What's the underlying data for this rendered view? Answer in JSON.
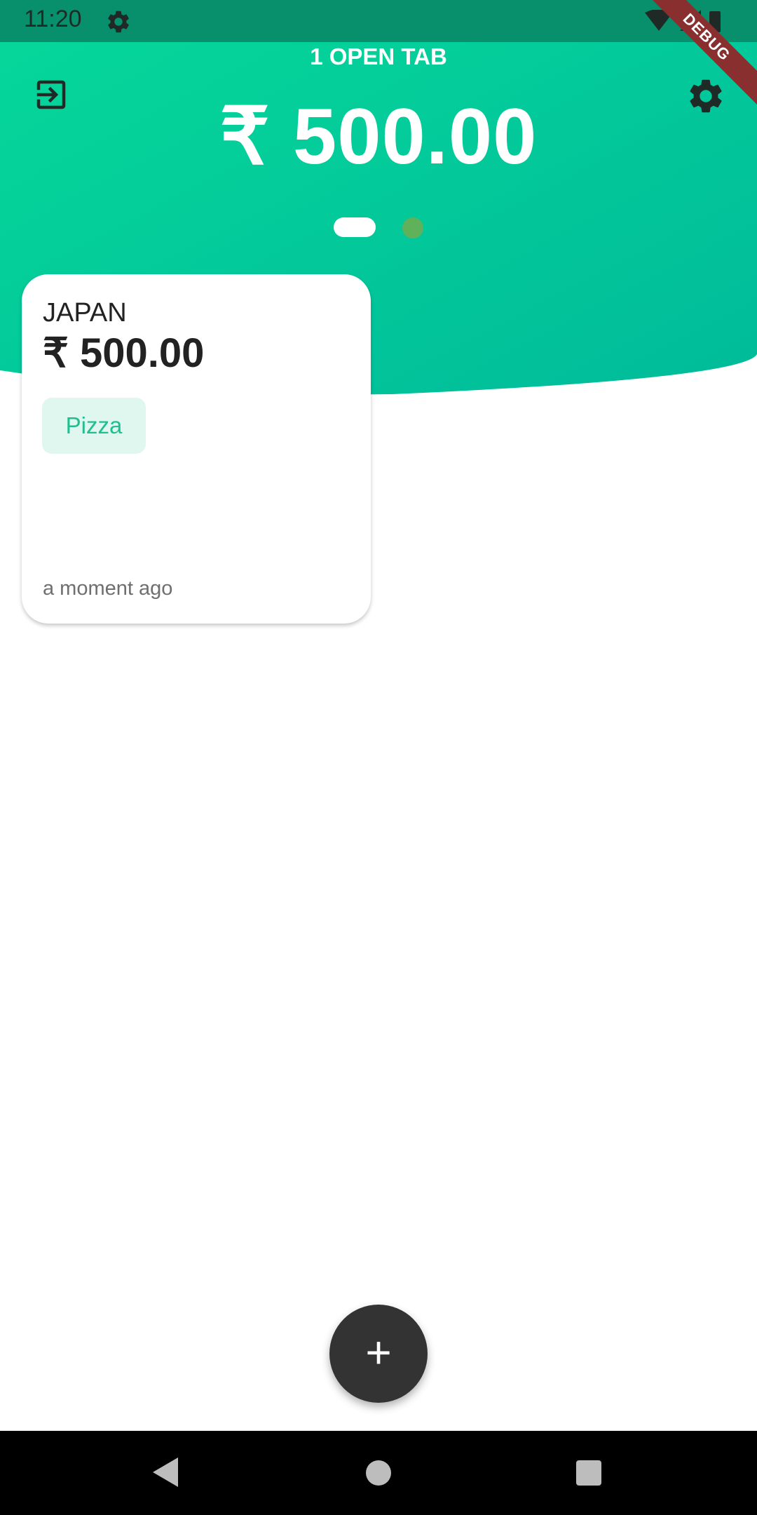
{
  "status_bar": {
    "time": "11:20"
  },
  "debug_banner": "DEBUG",
  "header": {
    "open_tabs_label": "1 OPEN TAB",
    "total_amount": "₹ 500.00"
  },
  "tabs": [
    {
      "name": "JAPAN",
      "amount": "₹ 500.00",
      "tag": "Pizza",
      "time": "a moment ago"
    }
  ],
  "fab": {
    "label": "+"
  },
  "colors": {
    "gradient_start": "#06d89a",
    "gradient_end": "#00bb9a",
    "status_bar": "#07906b",
    "tag_bg": "#e0f7f0",
    "tag_text": "#1fbf8f",
    "fab_bg": "#333333",
    "page_indicator_inactive": "#5fb15a"
  }
}
